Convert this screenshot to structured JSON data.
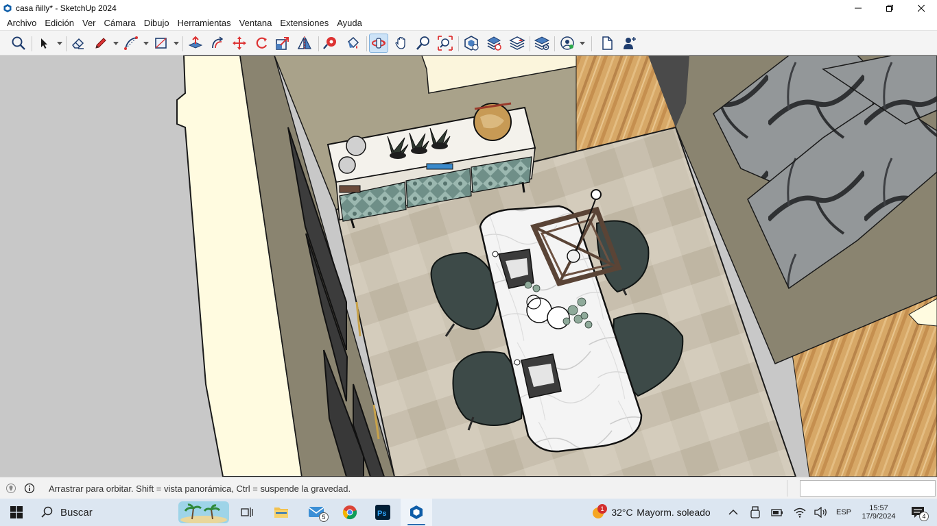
{
  "window": {
    "title": "casa ñilly* - SketchUp 2024",
    "controls": [
      "minimize-icon",
      "restore-icon",
      "close-icon"
    ]
  },
  "menu": [
    {
      "label": "Archivo"
    },
    {
      "label": "Edición"
    },
    {
      "label": "Ver"
    },
    {
      "label": "Cámara"
    },
    {
      "label": "Dibujo"
    },
    {
      "label": "Herramientas"
    },
    {
      "label": "Ventana"
    },
    {
      "label": "Extensiones"
    },
    {
      "label": "Ayuda"
    }
  ],
  "toolbar": {
    "tools": [
      {
        "icon": "search-icon",
        "tool": "search"
      },
      {
        "icon": "select-arrow-icon",
        "tool": "select",
        "dropdown": true
      },
      {
        "icon": "eraser-icon",
        "tool": "eraser"
      },
      {
        "icon": "pencil-icon",
        "tool": "line",
        "dropdown": true
      },
      {
        "icon": "arc-icon",
        "tool": "arc",
        "dropdown": true
      },
      {
        "icon": "rectangle-icon",
        "tool": "rectangle",
        "dropdown": true
      },
      {
        "icon": "push-pull-icon",
        "tool": "push-pull"
      },
      {
        "icon": "offset-icon",
        "tool": "offset"
      },
      {
        "icon": "move-icon",
        "tool": "move"
      },
      {
        "icon": "rotate-icon",
        "tool": "rotate"
      },
      {
        "icon": "scale-icon",
        "tool": "scale"
      },
      {
        "icon": "flip-icon",
        "tool": "flip"
      },
      {
        "icon": "tape-measure-icon",
        "tool": "tape-measure"
      },
      {
        "icon": "paint-bucket-icon",
        "tool": "paint-bucket"
      },
      {
        "icon": "orbit-icon",
        "tool": "orbit",
        "active": true
      },
      {
        "icon": "pan-icon",
        "tool": "pan"
      },
      {
        "icon": "zoom-icon",
        "tool": "zoom"
      },
      {
        "icon": "zoom-extents-icon",
        "tool": "zoom-extents"
      },
      {
        "icon": "3d-warehouse-icon",
        "tool": "3d-warehouse"
      },
      {
        "icon": "extension-warehouse-icon",
        "tool": "extension-warehouse"
      },
      {
        "icon": "layout-icon",
        "tool": "send-to-layout"
      },
      {
        "icon": "extension-manager-icon",
        "tool": "extension-manager"
      },
      {
        "icon": "account-icon",
        "tool": "account",
        "dropdown": true
      },
      {
        "icon": "new-file-icon",
        "tool": "new-file"
      },
      {
        "icon": "add-user-icon",
        "tool": "add-user"
      }
    ]
  },
  "status": {
    "hint": "Arrastrar para orbitar. Shift = vista panorámica, Ctrl = suspende la gravedad.",
    "measurements_value": ""
  },
  "taskbar": {
    "search_placeholder": "Buscar",
    "mail_badge": "5",
    "weather_badge": "1",
    "temperature": "32°C",
    "weather": "Mayorm. soleado",
    "language": "ESP",
    "time": "15:57",
    "date": "17/9/2024",
    "notifications": "4"
  },
  "colors": {
    "accent": "#2b6cb0",
    "taskbar_bg": "#dce6f1",
    "toolbar_bg": "#f4f4f4",
    "active_tool_bg": "#cde3f7",
    "chair_color": "#3d4a48",
    "wall_color": "#8c8672",
    "floor_wood": "#d7a867"
  }
}
